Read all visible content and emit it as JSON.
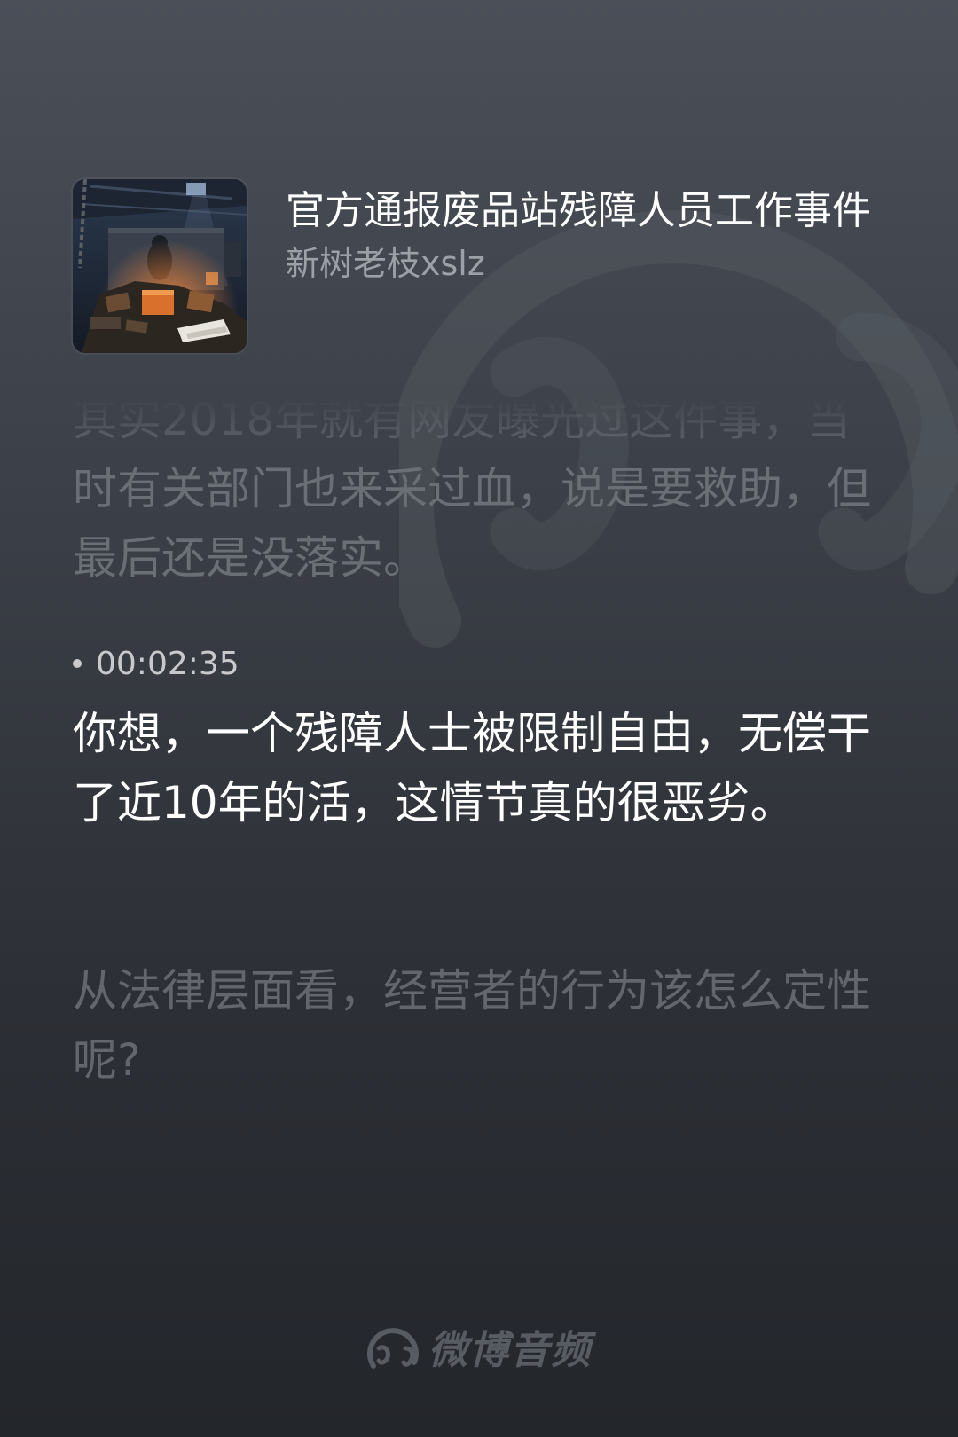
{
  "background_logo": {
    "icon": "weibo-audio-logo-icon",
    "color": "#5b6068"
  },
  "podcast": {
    "cover_image": "abandoned-warehouse-debris-cover",
    "title": "官方通报废品站残障人员工作事件",
    "author": "新树老枝xslz"
  },
  "lyrics": {
    "previous_text": "其实2018年就有网友曝光过这件事，当时有关部门也来采过血，说是要救助，但最后还是没落实。",
    "current_timestamp": "00:02:35",
    "current_text": "你想，一个残障人士被限制自由，无偿干了近10年的活，这情节真的很恶劣。",
    "next_text": "从法律层面看，经营者的行为该怎么定性呢?"
  },
  "footer": {
    "brand_icon": "weibo-audio-icon",
    "brand_name": "微博音频"
  },
  "colors": {
    "background_top": "#4a4f58",
    "background_bottom": "#23262b",
    "current_text": "#ffffff",
    "dim_text": "#6a6e75"
  }
}
